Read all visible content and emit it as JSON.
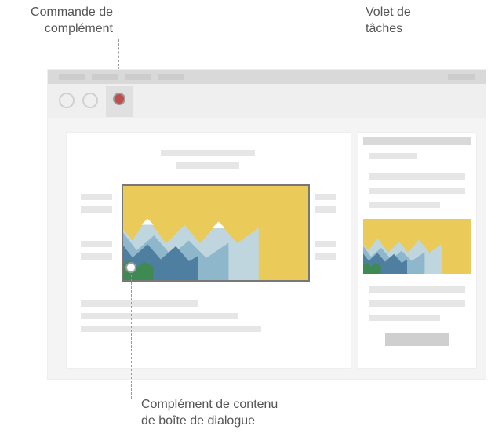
{
  "callouts": {
    "addin_command": {
      "line1": "Commande de",
      "line2": "complément"
    },
    "task_pane": {
      "line1": "Volet de",
      "line2": "tâches"
    },
    "content_dialog": {
      "line1": "Complément de contenu",
      "line2": "de boîte de dialogue"
    }
  },
  "colors": {
    "sky": "#eacb59",
    "sun": "#d9583a",
    "snow": "#ffffff",
    "far_mountain": "#bfd6df",
    "mid_mountain": "#8fb7cc",
    "near_mountain": "#4f7fa0",
    "grass": "#3e8a52",
    "addin_dot": "#c24c4c"
  }
}
